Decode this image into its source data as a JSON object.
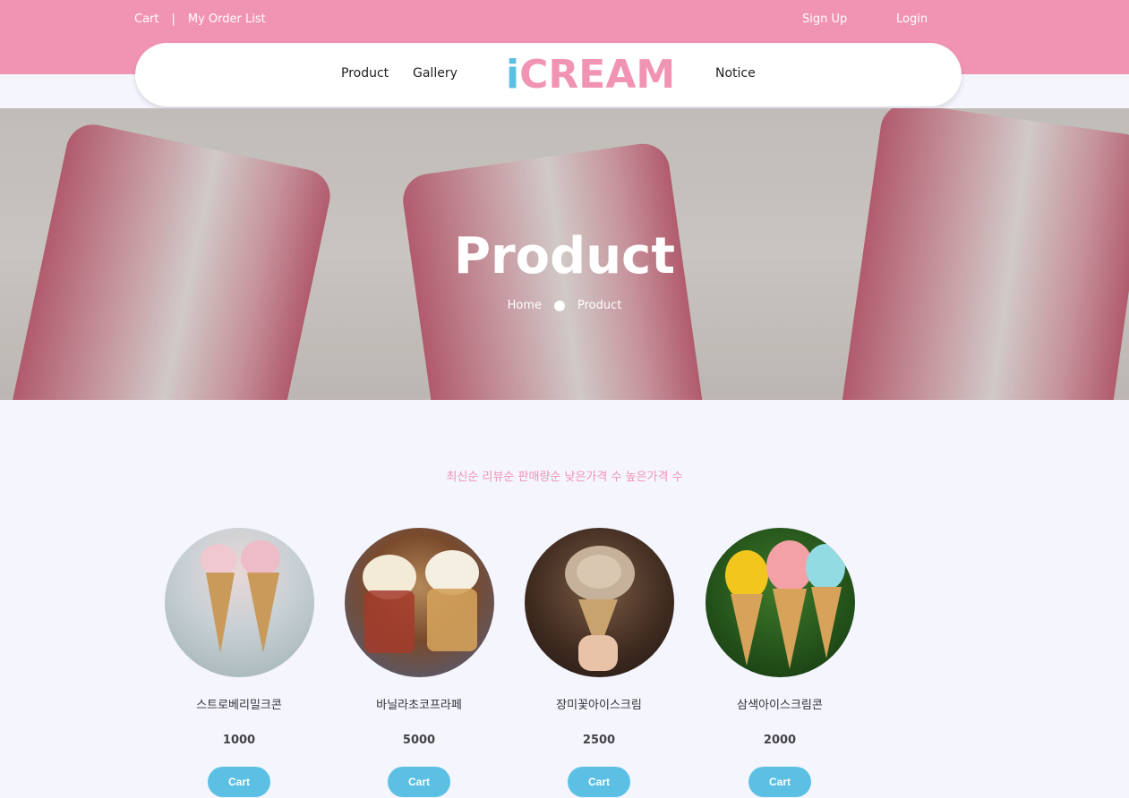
{
  "topbar": {
    "cart": "Cart",
    "separator": "|",
    "order_list": "My Order List",
    "signup": "Sign Up",
    "login": "Login"
  },
  "nav": {
    "product": "Product",
    "gallery": "Gallery",
    "logo_i": "i",
    "logo_rest": "CREAM",
    "notice": "Notice"
  },
  "hero": {
    "title": "Product",
    "breadcrumb_home": "Home",
    "breadcrumb_current": "Product"
  },
  "sort": {
    "options": [
      "최신순",
      "리뷰순",
      "판매량순",
      "낮은가격 수",
      "높은가격 수"
    ]
  },
  "products": [
    {
      "name": "스트로베리밀크콘",
      "price": "1000",
      "button": "Cart"
    },
    {
      "name": "바닐라초코프라페",
      "price": "5000",
      "button": "Cart"
    },
    {
      "name": "장미꽃아이스크림",
      "price": "2500",
      "button": "Cart"
    },
    {
      "name": "삼색아이스크림콘",
      "price": "2000",
      "button": "Cart"
    }
  ],
  "colors": {
    "brand_pink": "#f194b4",
    "brand_blue": "#5bc0e3",
    "background": "#f4f5fd"
  }
}
